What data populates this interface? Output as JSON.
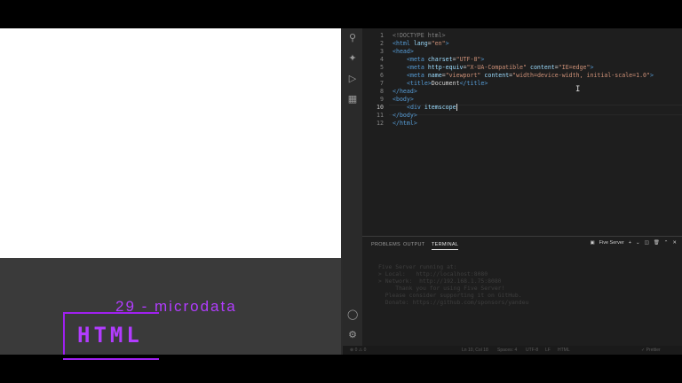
{
  "lesson": {
    "title": "29 - microdata",
    "badge": "HTML"
  },
  "editor": {
    "lines": [
      {
        "n": "1"
      },
      {
        "n": "2"
      },
      {
        "n": "3"
      },
      {
        "n": "4"
      },
      {
        "n": "5"
      },
      {
        "n": "6"
      },
      {
        "n": "7"
      },
      {
        "n": "8"
      },
      {
        "n": "9"
      },
      {
        "n": "10"
      },
      {
        "n": "11"
      },
      {
        "n": "12"
      }
    ],
    "active_line": "10",
    "code": {
      "l1": "<!DOCTYPE html>",
      "l2a": "<html",
      "l2b": " lang",
      "l2c": "=",
      "l2d": "\"en\"",
      "l2e": ">",
      "l3": "<head>",
      "l4a": "<meta",
      "l4b": " charset",
      "l4c": "=",
      "l4d": "\"UTF-8\"",
      "l4e": ">",
      "l5a": "<meta",
      "l5b": " http-equiv",
      "l5c": "=",
      "l5d": "\"X-UA-Compatible\"",
      "l5e": " content",
      "l5f": "=",
      "l5g": "\"IE=edge\"",
      "l5h": ">",
      "l6a": "<meta",
      "l6b": " name",
      "l6c": "=",
      "l6d": "\"viewport\"",
      "l6e": " content",
      "l6f": "=",
      "l6g": "\"width=device-width, initial-scale=1.0\"",
      "l6h": ">",
      "l7a": "<title>",
      "l7b": "Document",
      "l7c": "</title>",
      "l8": "</head>",
      "l9": "<body>",
      "l10a": "<div",
      "l10b": " itemscope",
      "l11": "</body>",
      "l12": "</html>"
    }
  },
  "panel": {
    "tabs": [
      "PROBLEMS",
      "OUTPUT",
      "TERMINAL"
    ],
    "active_tab": "TERMINAL",
    "terminal_name": "Five Server",
    "terminal_lines": [
      "Five Server running at:",
      "> Local:   http://localhost:8080",
      "> Network:  http://192.168.1.75:8080",
      "     Thank you for using Five Server!",
      "  Please consider supporting it on GitHub.",
      "  Donate: https://github.com/sponsors/yandeu"
    ]
  },
  "status": {
    "left": "⊗ 0 ⚠ 0",
    "position": "Ln 10, Col 18",
    "spaces": "Spaces: 4",
    "encoding": "UTF-8",
    "eol": "LF",
    "language": "HTML",
    "prettier": "✓ Prettier"
  }
}
